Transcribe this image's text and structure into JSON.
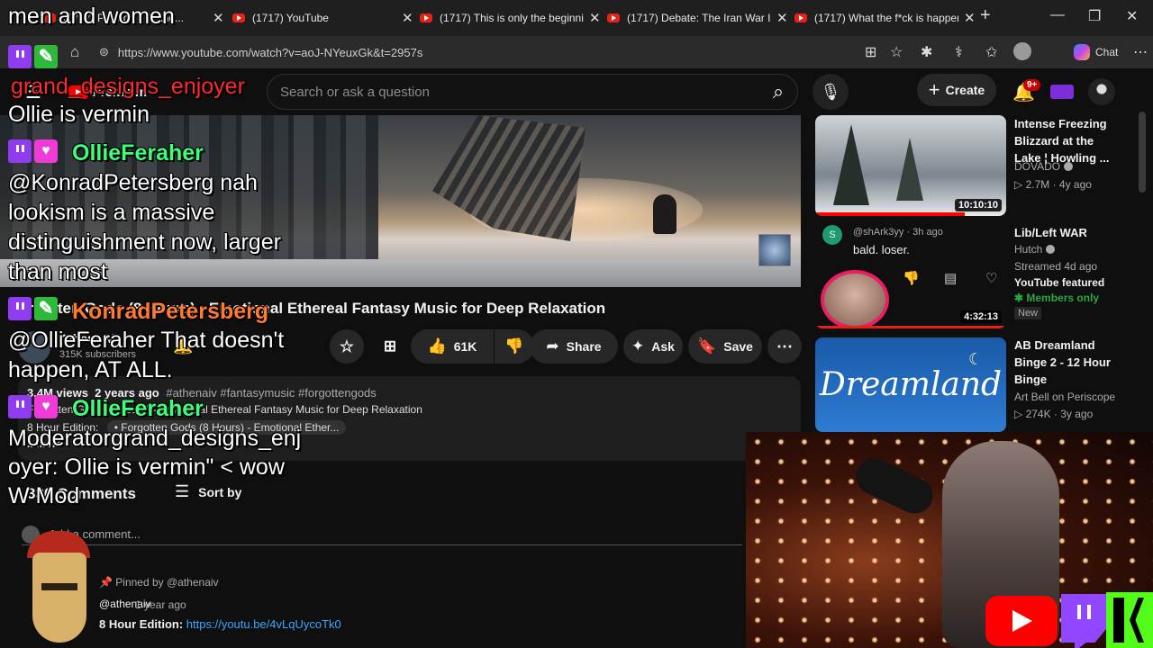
{
  "browser": {
    "tabs": [
      {
        "title": "(1717) Patreon - Grand..."
      },
      {
        "title": "(1717) YouTube"
      },
      {
        "title": "(1717) This is only the beginnin"
      },
      {
        "title": "(1717) Debate: The Iran War Is"
      },
      {
        "title": "(1717) What the f*ck is happen"
      }
    ],
    "url": "https://www.youtube.com/watch?v=aoJ-NYeuxGk&t=2957s",
    "chat_label": "Chat"
  },
  "youtube": {
    "logo_text": "Premium",
    "search_placeholder": "Search or ask a question",
    "create_label": "Create",
    "notification_count": "9+"
  },
  "video": {
    "title": "Forgotten Gods (8 Hours) - Emotional Ethereal Fantasy Music for Deep Relaxation",
    "channel": "AthenaIV",
    "subscribers": "315K subscribers",
    "likes": "61K",
    "share_label": "Share",
    "ask_label": "Ask",
    "save_label": "Save",
    "views": "3.4M views",
    "age": "2 years ago",
    "tags": "#athenaiv #fantasymusic #forgottengods",
    "desc_line1": "Forgotten Gods (8 Hours) - Emotional Ethereal Fantasy Music for Deep Relaxation",
    "desc_line2_label": "8 Hour Edition:",
    "desc_line2_link": "• Forgotten Gods (8 Hours) - Emotional Ether...",
    "desc_more": "...more"
  },
  "comments": {
    "count": "330 Comments",
    "sort_label": "Sort by",
    "add_placeholder": "Add a comment...",
    "pinned_by": "Pinned by @athenaiv",
    "author": "@athenaiv",
    "time": "1 year ago",
    "body_label": "8 Hour Edition:",
    "body_link": "https://youtu.be/4vLqUycoTk0"
  },
  "sidebar": {
    "items": [
      {
        "title": "Intense Freezing Blizzard at the Lake ¦ Howling ...",
        "channel": "DOVADO",
        "meta": "2.7M · 4y ago",
        "duration": "10:10:10"
      },
      {
        "title": "Lib/Left WAR",
        "channel": "Hutch",
        "meta": "Streamed 4d ago",
        "featured": "YouTube featured",
        "members": "Members only",
        "badge": "New",
        "duration": "4:32:13"
      },
      {
        "title": "AB Dreamland Binge 2 - 12 Hour Binge",
        "channel": "Art Bell on Periscope",
        "meta": "274K · 3y ago",
        "thumb_text": "Dreamland"
      }
    ],
    "comment": {
      "author": "@shArk3yy · 3h ago",
      "text": "bald. loser.",
      "initial": "S"
    }
  },
  "stream_chat": {
    "lines": [
      {
        "text": "men and women",
        "style": "msg"
      },
      {
        "text": "grand_designs_enjoyer",
        "style": "user-red"
      },
      {
        "text": "Ollie is vermin",
        "style": "msg"
      },
      {
        "text": "OllieFeraher",
        "style": "user-green"
      },
      {
        "text": "@KonradPetersberg nah",
        "style": "msg"
      },
      {
        "text": "lookism is a massive",
        "style": "msg"
      },
      {
        "text": "distinguishment now, larger",
        "style": "msg"
      },
      {
        "text": "than most",
        "style": "msg"
      },
      {
        "text": "KonradPetersberg",
        "style": "user-orange"
      },
      {
        "text": "@OllieFeraher That doesn't",
        "style": "msg"
      },
      {
        "text": "happen, AT ALL.",
        "style": "msg"
      },
      {
        "text": "OllieFeraher",
        "style": "user-green"
      },
      {
        "text": "Moderatorgrand_designs_enj",
        "style": "msg"
      },
      {
        "text": "oyer: Ollie is vermin\" < wow",
        "style": "msg"
      },
      {
        "text": "W Mod",
        "style": "msg"
      }
    ]
  }
}
